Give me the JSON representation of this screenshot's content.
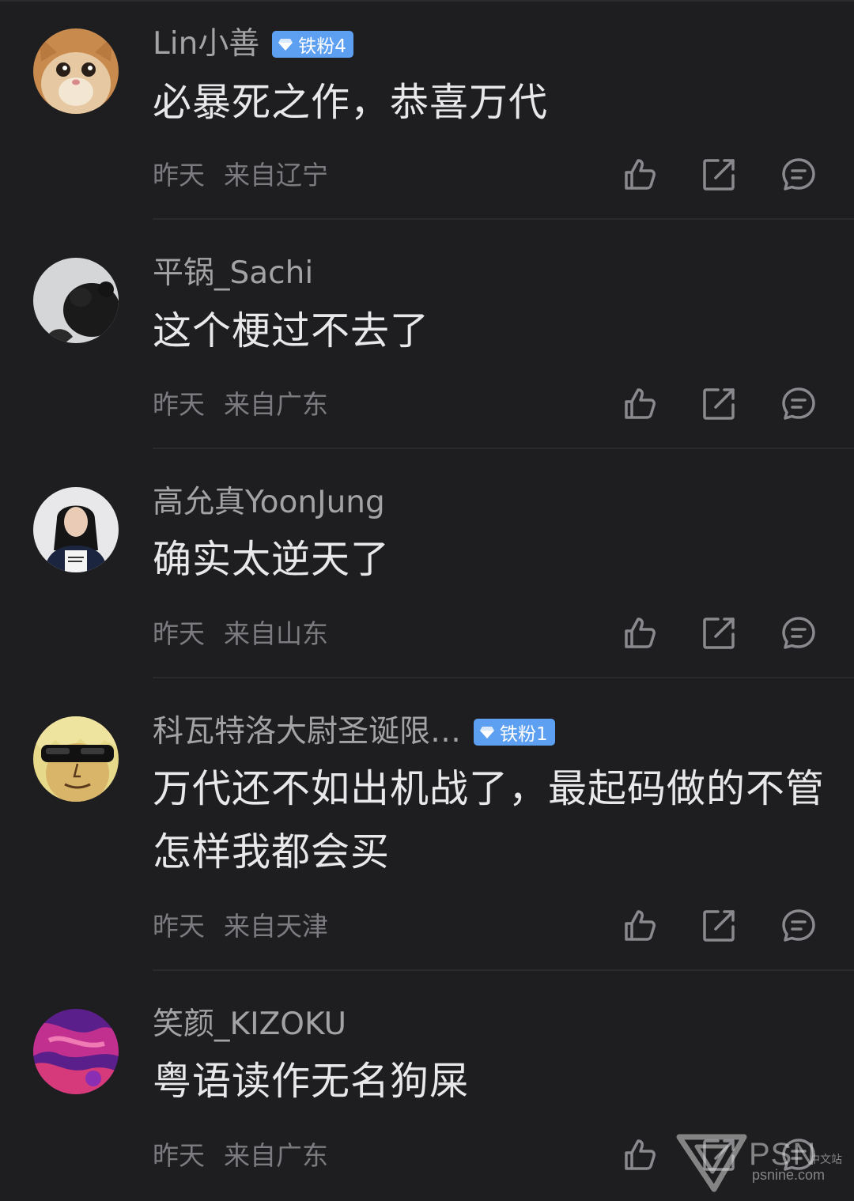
{
  "colors": {
    "background": "#1e1e20",
    "username": "#a3a3a6",
    "content": "#e8e8ea",
    "meta": "#7c7c80",
    "badge": "#5d9ff0",
    "divider": "#2a2a2d"
  },
  "comments": [
    {
      "username": "Lin小善",
      "badge": "铁粉4",
      "avatar": "cat-avatar",
      "content": "必暴死之作，恭喜万代",
      "time": "昨天",
      "location": "来自辽宁"
    },
    {
      "username": "平锅_Sachi",
      "badge": "",
      "avatar": "dark-hair-avatar",
      "content": "这个梗过不去了",
      "time": "昨天",
      "location": "来自广东"
    },
    {
      "username": "高允真YoonJung",
      "badge": "",
      "avatar": "woman-portrait-avatar",
      "content": "确实太逆天了",
      "time": "昨天",
      "location": "来自山东"
    },
    {
      "username": "科瓦特洛大尉圣诞限…",
      "badge": "铁粉1",
      "avatar": "anime-sunglasses-avatar",
      "content": "万代还不如出机战了，最起码做的不管怎样我都会买",
      "time": "昨天",
      "location": "来自天津"
    },
    {
      "username": "笑颜_KIZOKU",
      "badge": "",
      "avatar": "purple-abstract-avatar",
      "content": "粤语读作无名狗屎",
      "time": "昨天",
      "location": "来自广东"
    }
  ],
  "actions": {
    "like": "thumbs-up-icon",
    "share": "share-icon",
    "reply": "reply-icon"
  },
  "watermark": {
    "brand": "PSN",
    "sub": "中文站",
    "domain": "psnine.com"
  }
}
